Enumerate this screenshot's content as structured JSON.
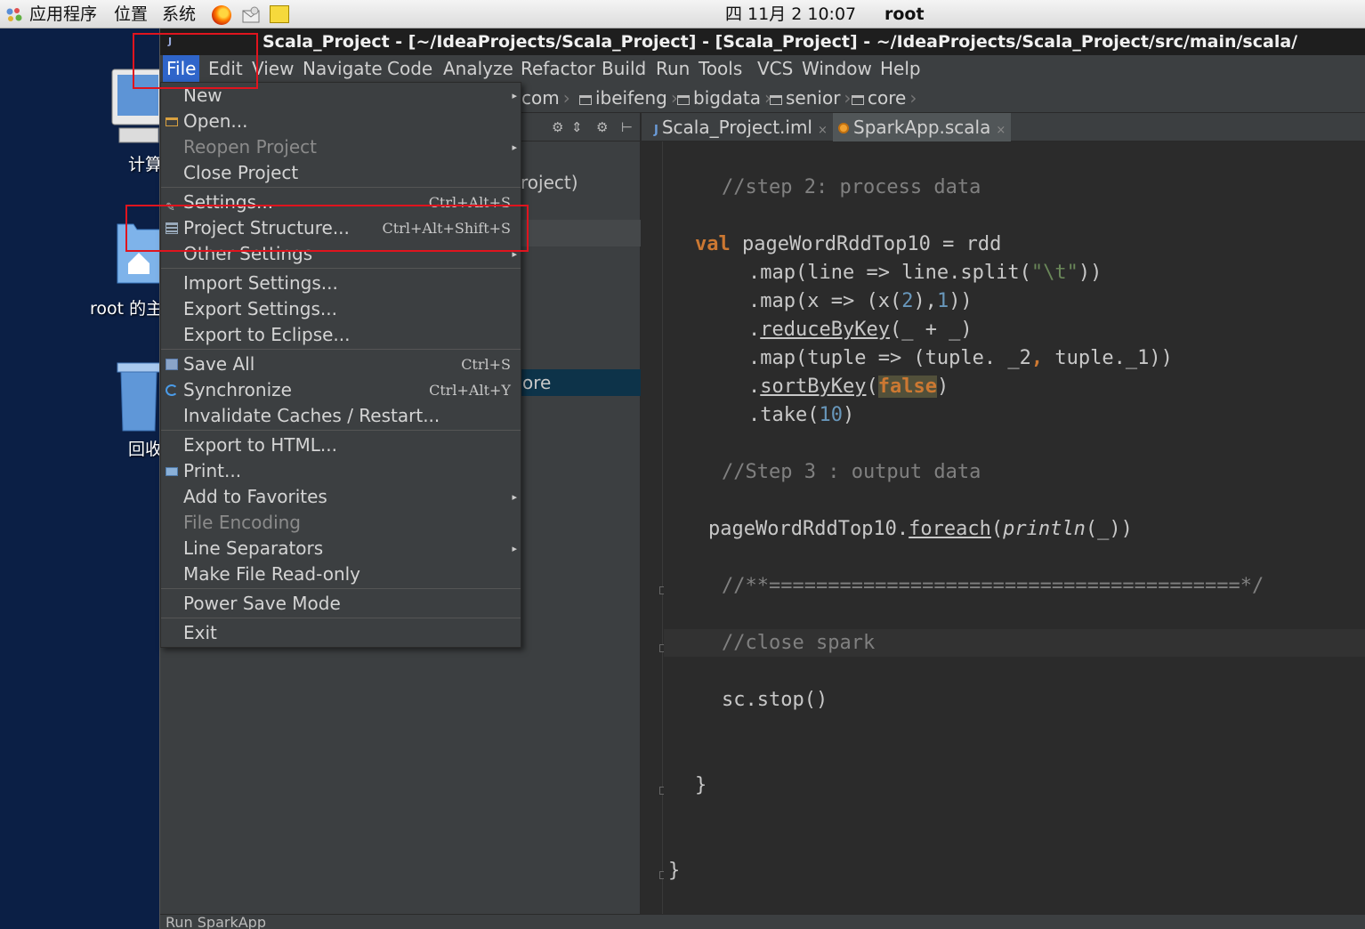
{
  "panel": {
    "applications": "应用程序",
    "places": "位置",
    "system": "系统",
    "datetime": "四 11月  2 10:07",
    "user": "root"
  },
  "desktop": {
    "computer_label": "计算",
    "home_label": "root 的主",
    "trash_label": "回收"
  },
  "window": {
    "title": "Scala_Project - [~/IdeaProjects/Scala_Project] - [Scala_Project] - ~/IdeaProjects/Scala_Project/src/main/scala/"
  },
  "menubar": {
    "file": "File",
    "edit": "Edit",
    "view": "View",
    "navigate": "Navigate",
    "code": "Code",
    "analyze": "Analyze",
    "refactor": "Refactor",
    "build": "Build",
    "run": "Run",
    "tools": "Tools",
    "vcs": "VCS",
    "window": "Window",
    "help": "Help"
  },
  "breadcrumbs": [
    "com",
    "ibeifeng",
    "bigdata",
    "senior",
    "core"
  ],
  "project_tree": {
    "row1": "roject)",
    "row2": "ore"
  },
  "editor_tabs": [
    {
      "label": "Scala_Project.iml"
    },
    {
      "label": "SparkApp.scala"
    }
  ],
  "code": {
    "l1": "//step 2: process data",
    "l2_kw": "val",
    "l2_rest": " pageWordRddTop10 = rdd",
    "l3_a": ".map(line => line.split(",
    "l3_str": "\"\\t\"",
    "l3_b": "))",
    "l4_a": ".map(x => (x(",
    "l4_n1": "2",
    "l4_b": "),",
    "l4_n2": "1",
    "l4_c": "))",
    "l5_a": ".",
    "l5_m": "reduceByKey",
    "l5_b": "(_ + _)",
    "l6_a": ".map(tuple => (tuple. _2",
    "l6_comma": ",",
    "l6_b": " tuple._1))",
    "l7_a": ".",
    "l7_m": "sortByKey",
    "l7_b": "(",
    "l7_false": "false",
    "l7_c": ")",
    "l8_a": ".take(",
    "l8_n": "10",
    "l8_b": ")",
    "l9": "//Step 3 : output data",
    "l10_a": "pageWordRddTop10.",
    "l10_m": "foreach",
    "l10_b": "(",
    "l10_i": "println",
    "l10_c": "(_))",
    "l11": "//**========================================*/",
    "l12": "//close spark",
    "l13": "sc.stop()",
    "l14": "}",
    "l15": "}"
  },
  "status_bar": {
    "text": "Run  SparkApp"
  },
  "file_menu": {
    "new": "New",
    "open": "Open...",
    "reopen_project": "Reopen Project",
    "close_project": "Close Project",
    "settings": "Settings...",
    "settings_shortcut": "Ctrl+Alt+S",
    "project_structure": "Project Structure...",
    "project_structure_shortcut": "Ctrl+Alt+Shift+S",
    "other_settings": "Other Settings",
    "import_settings": "Import Settings...",
    "export_settings": "Export Settings...",
    "export_eclipse": "Export to Eclipse...",
    "save_all": "Save All",
    "save_all_shortcut": "Ctrl+S",
    "synchronize": "Synchronize",
    "synchronize_shortcut": "Ctrl+Alt+Y",
    "invalidate_caches": "Invalidate Caches / Restart...",
    "export_html": "Export to HTML...",
    "print": "Print...",
    "add_favorites": "Add to Favorites",
    "file_encoding": "File Encoding",
    "line_separators": "Line Separators",
    "make_readonly": "Make File Read-only",
    "power_save": "Power Save Mode",
    "exit": "Exit"
  },
  "colors": {
    "menu_active": "#2f65ca",
    "highlight_box": "#e0141e",
    "keyword": "#cc7832",
    "comment": "#808080",
    "string": "#6a8759",
    "number": "#6897bb"
  }
}
